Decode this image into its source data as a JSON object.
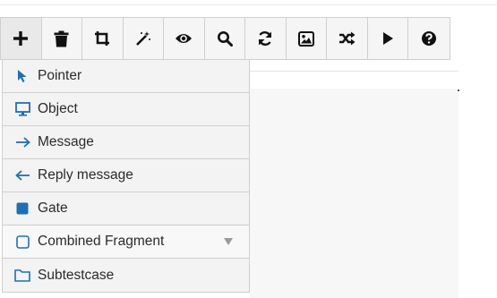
{
  "toolbar": {
    "buttons": [
      {
        "icon": "plus-icon"
      },
      {
        "icon": "trash-icon"
      },
      {
        "icon": "crop-icon"
      },
      {
        "icon": "magic-wand-icon"
      },
      {
        "icon": "eye-icon"
      },
      {
        "icon": "search-icon"
      },
      {
        "icon": "refresh-icon"
      },
      {
        "icon": "image-icon"
      },
      {
        "icon": "shuffle-icon"
      },
      {
        "icon": "play-icon"
      },
      {
        "icon": "help-icon"
      }
    ]
  },
  "menu": {
    "items": [
      {
        "label": "Pointer",
        "icon": "pointer-icon"
      },
      {
        "label": "Object",
        "icon": "monitor-icon"
      },
      {
        "label": "Message",
        "icon": "arrow-right-icon"
      },
      {
        "label": "Reply message",
        "icon": "arrow-left-icon"
      },
      {
        "label": "Gate",
        "icon": "filled-square-icon"
      },
      {
        "label": "Combined Fragment",
        "icon": "square-outline-icon"
      },
      {
        "label": "Subtestcase",
        "icon": "folder-icon"
      }
    ]
  },
  "colors": {
    "accent": "#1f6fb2",
    "border": "#cfcfcf",
    "menu_bg": "#f3f3f3"
  }
}
